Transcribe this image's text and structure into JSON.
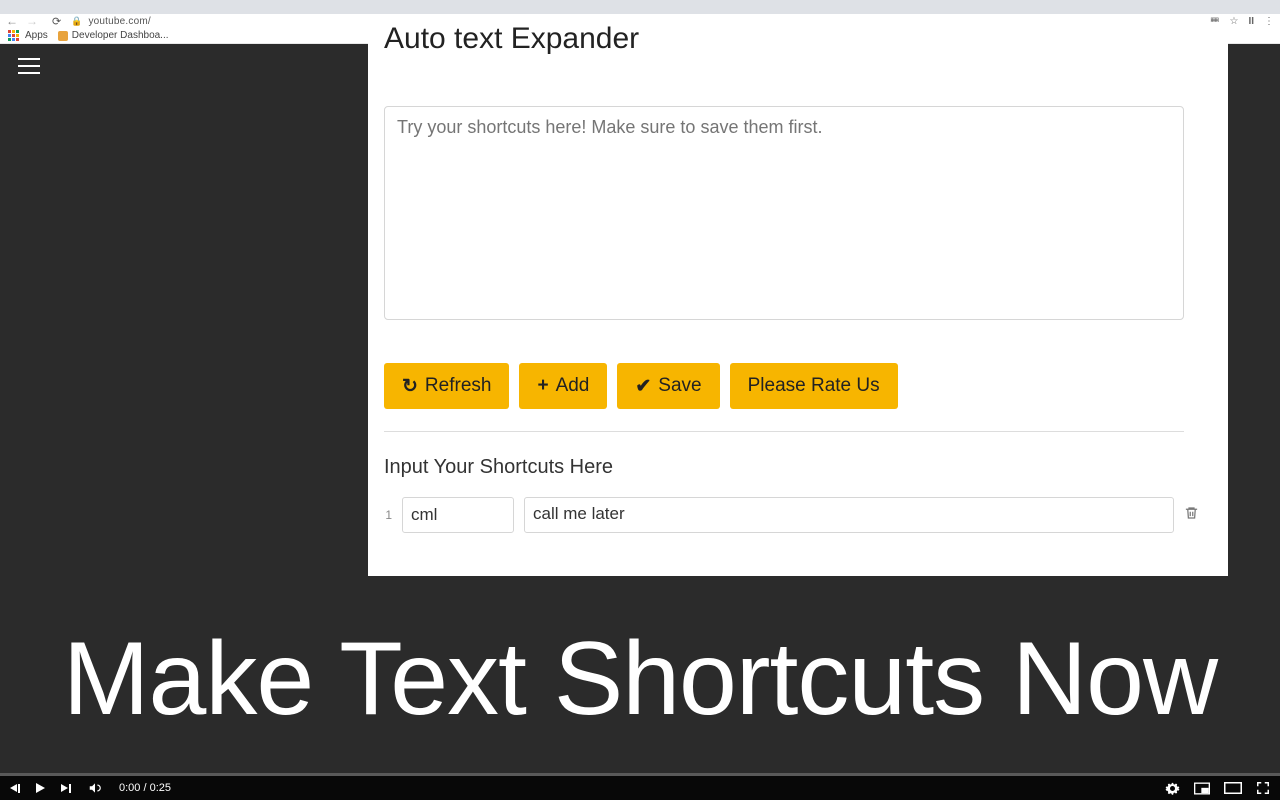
{
  "browser": {
    "url": "youtube.com/",
    "bookmarks": {
      "apps_label": "Apps",
      "dev_dashboard": "Developer Dashboa..."
    }
  },
  "popup": {
    "title": "Auto text Expander",
    "try_placeholder": "Try your shortcuts here! Make sure to save them first.",
    "buttons": {
      "refresh": "Refresh",
      "add": "Add",
      "save": "Save",
      "rate": "Please Rate Us"
    },
    "section_label": "Input Your Shortcuts Here",
    "rows": [
      {
        "num": "1",
        "short": "cml",
        "long": "call me later"
      }
    ]
  },
  "banner": "Make Text Shortcuts Now",
  "video": {
    "time": "0:00 / 0:25"
  }
}
